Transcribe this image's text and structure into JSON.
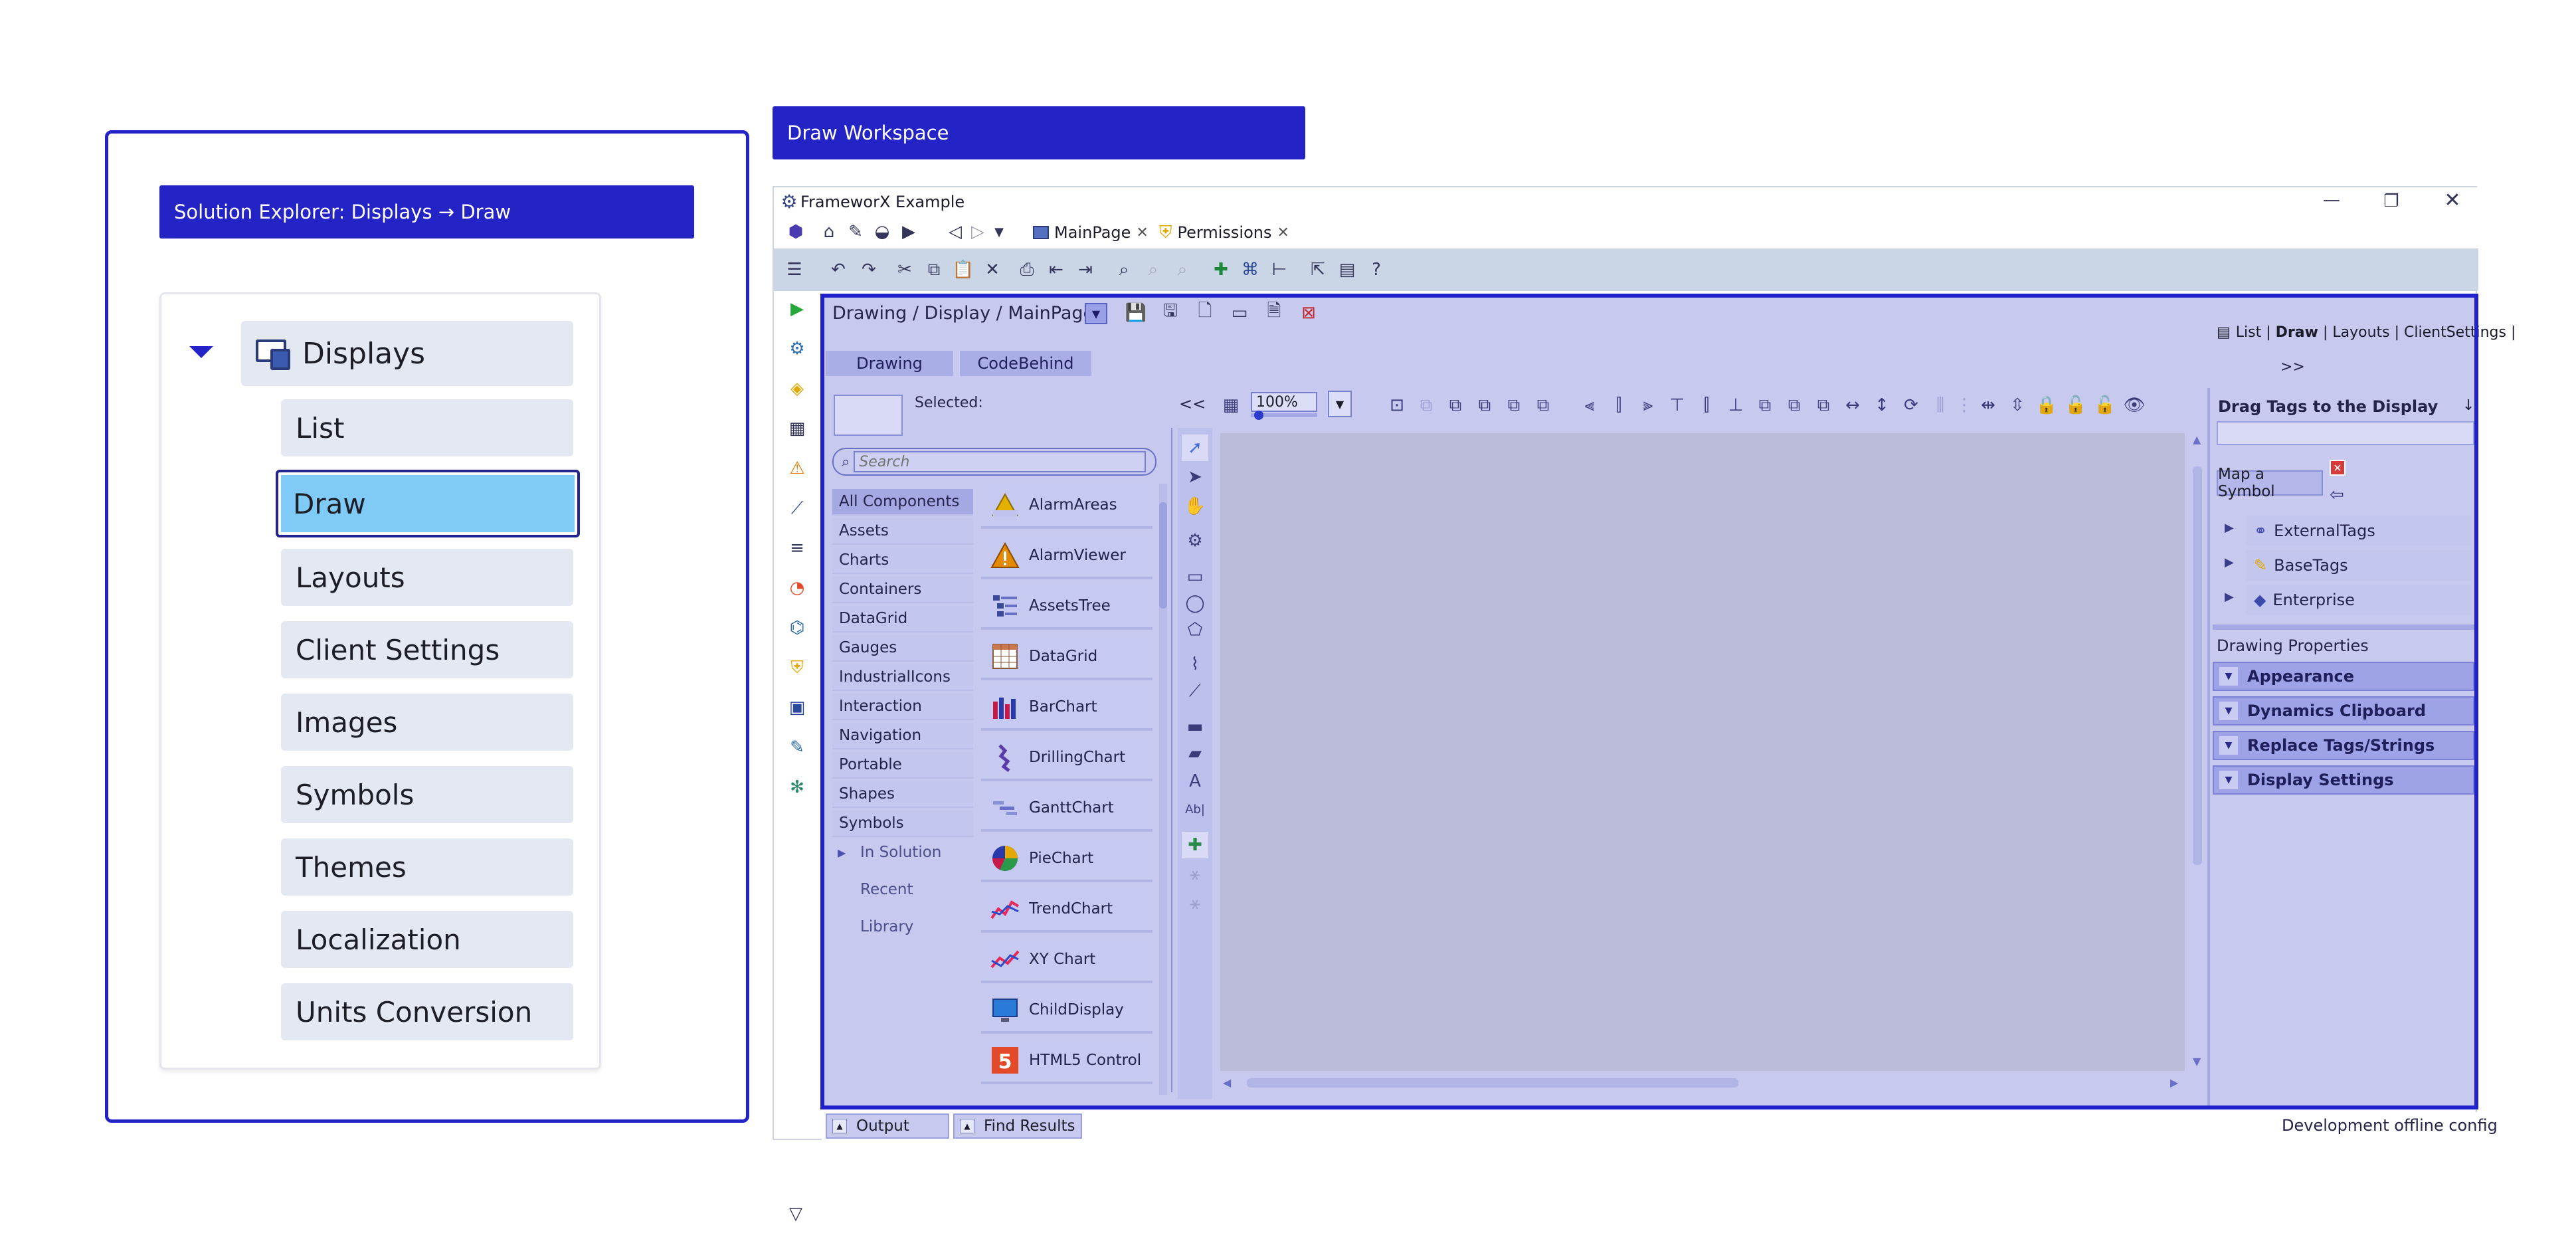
{
  "callouts": {
    "solution_explorer": "Solution Explorer: Displays → Draw",
    "draw_workspace": "Draw Workspace"
  },
  "tree": {
    "root": "Displays",
    "items": [
      {
        "label": "List"
      },
      {
        "label": "Draw",
        "selected": true
      },
      {
        "label": "Layouts"
      },
      {
        "label": "Client Settings"
      },
      {
        "label": "Images"
      },
      {
        "label": "Symbols"
      },
      {
        "label": "Themes"
      },
      {
        "label": "Localization"
      },
      {
        "label": "Units Conversion"
      }
    ]
  },
  "window": {
    "title": "FrameworX Example",
    "tabs": [
      {
        "label": "MainPage",
        "icon": "display-icon"
      },
      {
        "label": "Permissions",
        "icon": "shield-icon"
      }
    ]
  },
  "workspace": {
    "breadcrumb": "Drawing / Display / MainPage",
    "nav_links": {
      "list": "List",
      "sep1": " | ",
      "draw": "Draw",
      "sep2": " | ",
      "layouts": "Layouts",
      "sep3": " | ",
      "client_settings": "ClientSettings",
      "sep4": " |"
    },
    "subtabs": [
      "Drawing",
      "CodeBehind"
    ],
    "expand": ">>",
    "selected_label": "Selected:",
    "search_placeholder": "Search",
    "categories": [
      "All Components",
      "Assets",
      "Charts",
      "Containers",
      "DataGrid",
      "Gauges",
      "IndustrialIcons",
      "Interaction",
      "Navigation",
      "Portable",
      "Shapes",
      "Symbols"
    ],
    "subcategories": [
      "In Solution",
      "Recent",
      "Library"
    ],
    "components": [
      "AlarmAreas",
      "AlarmViewer",
      "AssetsTree",
      "DataGrid",
      "BarChart",
      "DrillingChart",
      "GanttChart",
      "PieChart",
      "TrendChart",
      "XY Chart",
      "ChildDisplay",
      "HTML5 Control"
    ],
    "collapse": "<<",
    "zoom": "100%",
    "zoom_fraction": 0.05
  },
  "right_panel": {
    "drag_tags_title": "Drag Tags to the Display",
    "drag_tags_pin": "↓",
    "map_symbol": "Map a Symbol",
    "tag_groups": [
      "ExternalTags",
      "BaseTags",
      "Enterprise"
    ],
    "drawing_properties_title": "Drawing Properties",
    "properties": [
      "Appearance",
      "Dynamics Clipboard",
      "Replace Tags/Strings",
      "Display Settings"
    ]
  },
  "bottom": {
    "output": "Output",
    "find_results": "Find Results",
    "status": "Development offline config"
  },
  "colors": {
    "accent": "#2424c6",
    "selection": "#7fcaf7",
    "workspace_bg": "#c7c9ef",
    "canvas_bg": "#bbbcd9"
  }
}
